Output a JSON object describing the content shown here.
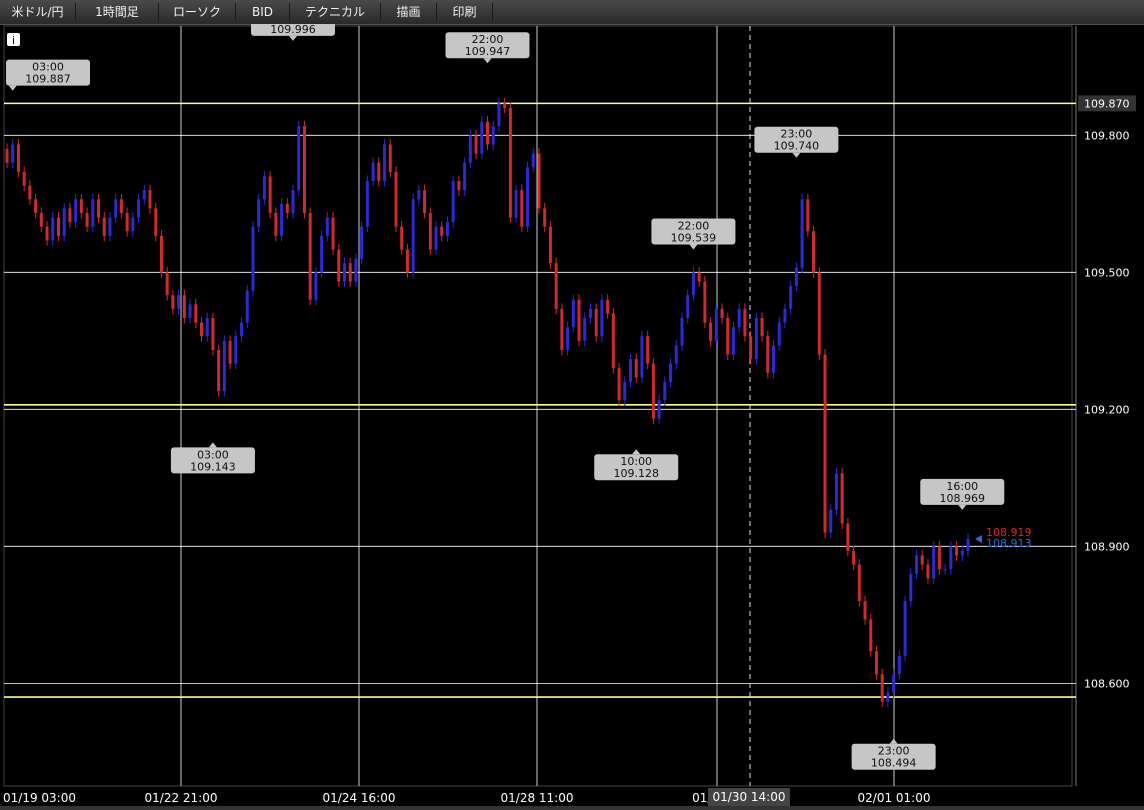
{
  "toolbar": {
    "pair": "米ドル/円",
    "interval": "1時間足",
    "chart_style": "ローソク",
    "price_side": "BID",
    "technical": "テクニカル",
    "draw": "描画",
    "print": "印刷",
    "info_icon": "info-icon"
  },
  "colors": {
    "background": "#000000",
    "grid": "#ffffff",
    "up_candle": "#2a2ad8",
    "down_candle": "#d22a2a",
    "horizontal_line": "#ffff80",
    "callout_bg": "#c6c6c6",
    "bid_price": "#e0202a",
    "ask_price": "#2a6ad8"
  },
  "chart_data": {
    "type": "candlestick",
    "symbol": "米ドル/円",
    "timeframe": "1時間足",
    "y_ticks": [
      "109.800",
      "109.500",
      "109.200",
      "108.900",
      "108.600"
    ],
    "y_tick_values": [
      109.8,
      109.5,
      109.2,
      108.9,
      108.6
    ],
    "ylim": [
      108.37,
      110.0
    ],
    "x_ticks": [
      "01/19 03:00",
      "01/22 21:00",
      "01/24 16:00",
      "01/28 11:00",
      "01/30 ...",
      "02/01 01:00"
    ],
    "crosshair": {
      "label": "01/30 14:00"
    },
    "horizontal_lines": [
      {
        "value": 109.87,
        "label": "109.870"
      },
      {
        "value": 109.21
      },
      {
        "value": 108.57
      }
    ],
    "current_price": {
      "bid": "108.919",
      "ask": "108.913",
      "value": 108.916
    },
    "annotations": [
      {
        "time": "03:00",
        "price": "109.887",
        "value": 109.887,
        "pos": "above",
        "bar": 1
      },
      {
        "time": "",
        "price": "109.996",
        "value": 109.996,
        "pos": "above",
        "bar": 50
      },
      {
        "time": "22:00",
        "price": "109.947",
        "value": 109.947,
        "pos": "above",
        "bar": 84
      },
      {
        "time": "23:00",
        "price": "109.740",
        "value": 109.74,
        "pos": "above",
        "bar": 138
      },
      {
        "time": "22:00",
        "price": "109.539",
        "value": 109.539,
        "pos": "above",
        "bar": 120
      },
      {
        "time": "03:00",
        "price": "109.143",
        "value": 109.143,
        "pos": "below",
        "bar": 36
      },
      {
        "time": "10:00",
        "price": "109.128",
        "value": 109.128,
        "pos": "below",
        "bar": 110
      },
      {
        "time": "16:00",
        "price": "108.969",
        "value": 108.969,
        "pos": "above",
        "bar": 167
      },
      {
        "time": "23:00",
        "price": "108.494",
        "value": 108.494,
        "pos": "below",
        "bar": 155
      }
    ],
    "close": [
      109.74,
      109.78,
      109.72,
      109.69,
      109.66,
      109.63,
      109.6,
      109.57,
      109.62,
      109.58,
      109.64,
      109.61,
      109.66,
      109.63,
      109.6,
      109.66,
      109.62,
      109.58,
      109.62,
      109.66,
      109.63,
      109.59,
      109.62,
      109.66,
      109.68,
      109.64,
      109.58,
      109.5,
      109.45,
      109.42,
      109.45,
      109.4,
      109.43,
      109.39,
      109.36,
      109.4,
      109.33,
      109.24,
      109.35,
      109.3,
      109.36,
      109.39,
      109.46,
      109.6,
      109.66,
      109.71,
      109.63,
      109.58,
      109.65,
      109.63,
      109.68,
      109.82,
      109.63,
      109.44,
      109.5,
      109.58,
      109.62,
      109.55,
      109.48,
      109.52,
      109.48,
      109.53,
      109.6,
      109.7,
      109.74,
      109.7,
      109.78,
      109.72,
      109.6,
      109.55,
      109.5,
      109.66,
      109.68,
      109.63,
      109.55,
      109.6,
      109.58,
      109.61,
      109.7,
      109.68,
      109.74,
      109.8,
      109.76,
      109.83,
      109.78,
      109.82,
      109.87,
      109.86,
      109.62,
      109.68,
      109.6,
      109.73,
      109.76,
      109.64,
      109.6,
      109.52,
      109.42,
      109.33,
      109.38,
      109.44,
      109.35,
      109.4,
      109.42,
      109.36,
      109.44,
      109.41,
      109.29,
      109.22,
      109.26,
      109.31,
      109.27,
      109.36,
      109.3,
      109.18,
      109.22,
      109.26,
      109.3,
      109.34,
      109.4,
      109.45,
      109.5,
      109.48,
      109.39,
      109.35,
      109.42,
      109.4,
      109.32,
      109.38,
      109.42,
      109.36,
      109.31,
      109.4,
      109.36,
      109.28,
      109.34,
      109.39,
      109.42,
      109.47,
      109.51,
      109.66,
      109.59,
      109.5,
      109.32,
      108.93,
      108.98,
      109.06,
      108.95,
      108.89,
      108.86,
      108.78,
      108.74,
      108.67,
      108.62,
      108.56,
      108.58,
      108.62,
      108.66,
      108.78,
      108.84,
      108.88,
      108.86,
      108.83,
      108.9,
      108.85,
      108.85,
      108.9,
      108.88,
      108.89,
      108.916
    ]
  }
}
